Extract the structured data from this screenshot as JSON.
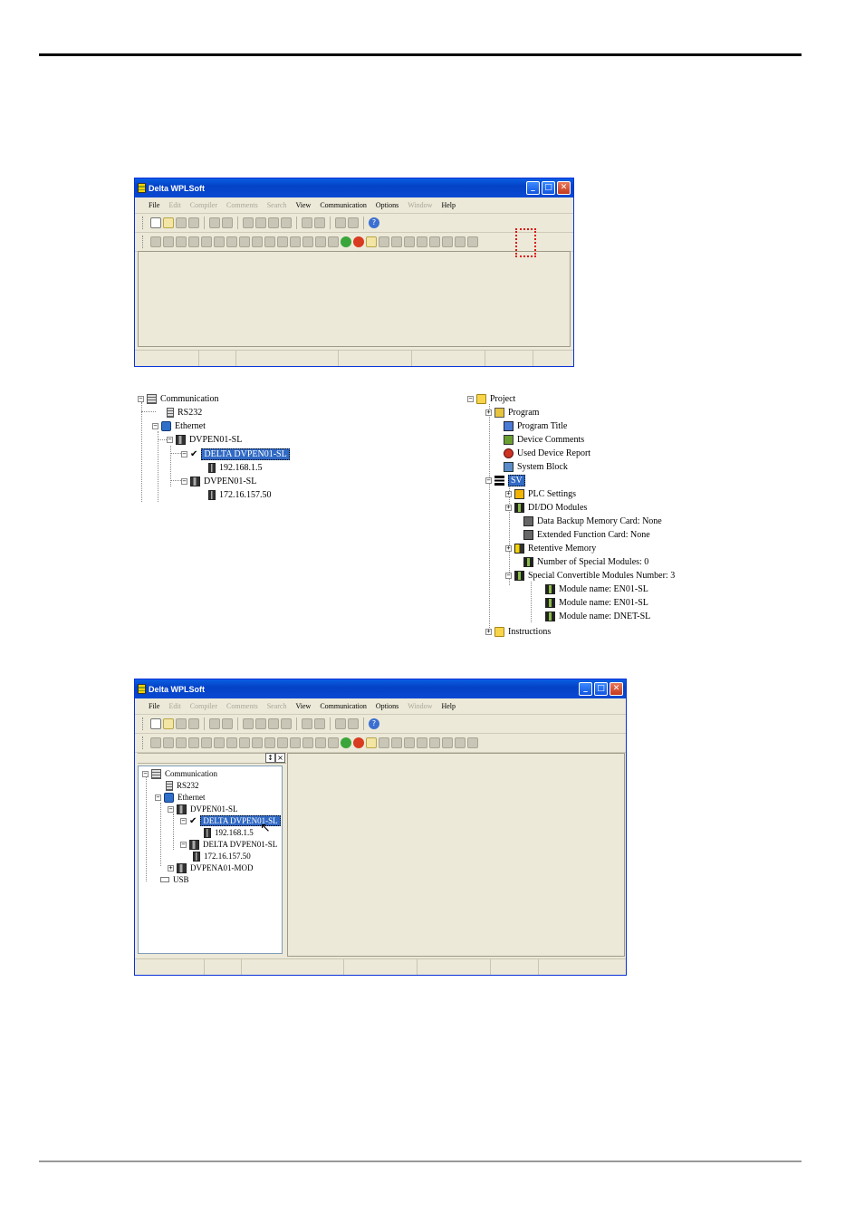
{
  "window1": {
    "title": "Delta WPLSoft",
    "menu": [
      "File",
      "Edit",
      "Compiler",
      "Comments",
      "Search",
      "View",
      "Communication",
      "Options",
      "Window",
      "Help"
    ],
    "menu_disabled": [
      false,
      true,
      true,
      true,
      true,
      false,
      false,
      false,
      true,
      false
    ]
  },
  "tree_comm": {
    "root": "Communication",
    "rs232": "RS232",
    "ethernet": "Ethernet",
    "dev1": "DVPEN01-SL",
    "dev1_child": "DELTA DVPEN01-SL",
    "dev1_ip": "192.168.1.5",
    "dev2": "DVPEN01-SL",
    "dev2_ip": "172.16.157.50"
  },
  "tree_project": {
    "root": "Project",
    "program": "Program",
    "program_title": "Program Title",
    "device_comments": "Device Comments",
    "used_device_report": "Used Device Report",
    "system_block": "System Block",
    "sv": "SV",
    "plc_settings": "PLC Settings",
    "dido_modules": "DI/DO Modules",
    "data_backup": "Data Backup Memory Card: None",
    "ext_function_card": "Extended Function Card: None",
    "retentive_memory": "Retentive Memory",
    "num_special_modules": "Number of Special Modules: 0",
    "special_convertible": "Special Convertible Modules Number: 3",
    "module1": "Module name: EN01-SL",
    "module2": "Module name: EN01-SL",
    "module3": "Module name: DNET-SL",
    "instructions": "Instructions"
  },
  "window2": {
    "title": "Delta WPLSoft",
    "menu": [
      "File",
      "Edit",
      "Compiler",
      "Comments",
      "Search",
      "View",
      "Communication",
      "Options",
      "Window",
      "Help"
    ],
    "menu_disabled": [
      false,
      true,
      true,
      true,
      true,
      false,
      false,
      false,
      true,
      false
    ],
    "panel_buttons": [
      "↕",
      "×"
    ],
    "tree": {
      "root": "Communication",
      "rs232": "RS232",
      "ethernet": "Ethernet",
      "dev1": "DVPEN01-SL",
      "dev1_child": "DELTA DVPEN01-SL",
      "dev1_ip": "192.168.1.5",
      "dev2": "DELTA DVPEN01-SL",
      "dev2_ip": "172.16.157.50",
      "dev3": "DVPENA01-MOD",
      "usb": "USB"
    }
  },
  "colors": {
    "titlebar": "#0a5fe3",
    "window_bg": "#ece9d8",
    "selection": "#316ac5",
    "highlight_box": "#e01010"
  },
  "icons": [
    "minimize-icon",
    "maximize-icon",
    "close-icon",
    "expand-icon",
    "collapse-icon",
    "checkmark-icon",
    "mouse-cursor-icon"
  ]
}
